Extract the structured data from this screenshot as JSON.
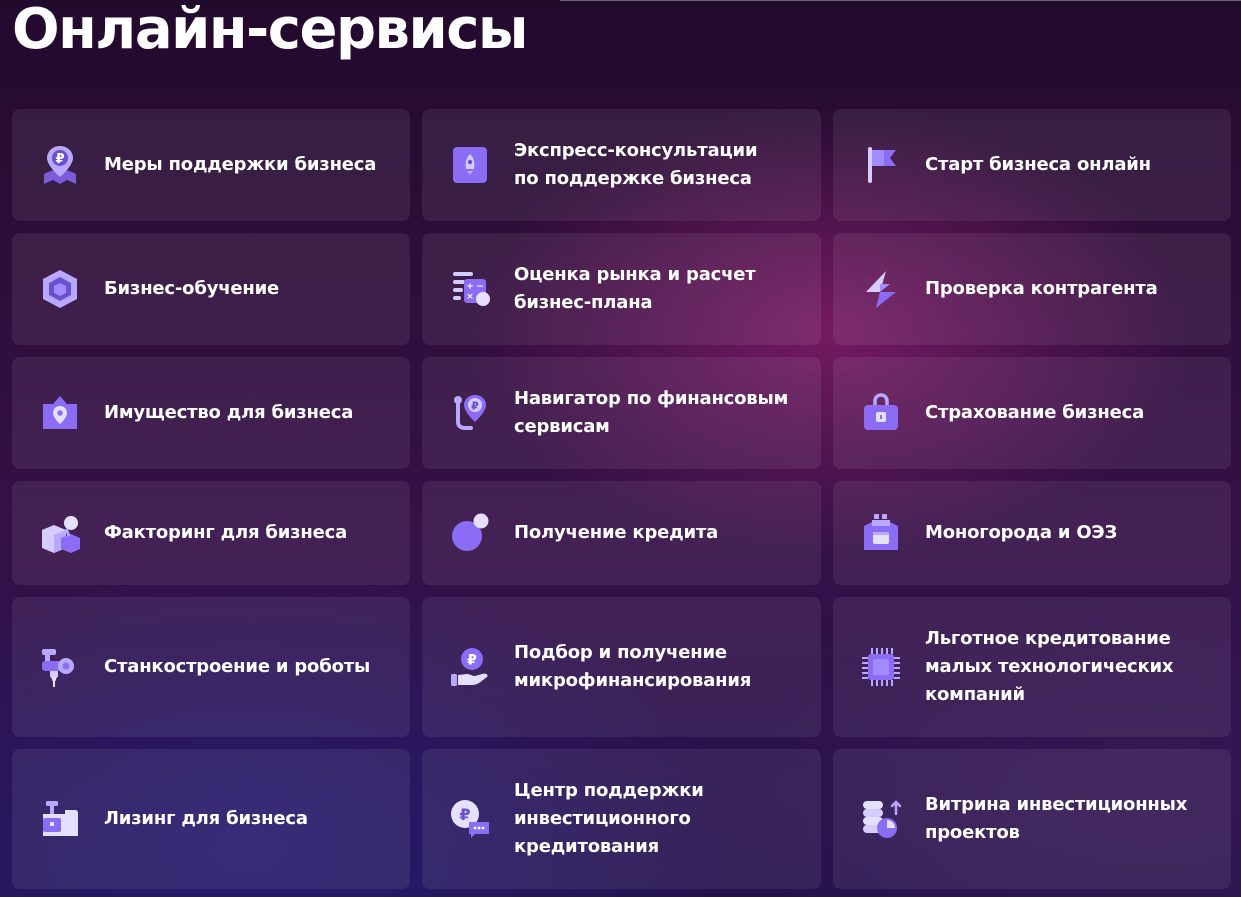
{
  "page": {
    "title": "Онлайн-сервисы"
  },
  "colors": {
    "accent": "#8b6cf5",
    "accent_light": "#c3b3ff",
    "card_background": "rgba(255,255,255,0.075)"
  },
  "services": [
    {
      "label": "Меры поддержки бизнеса",
      "icon": "map-ruble-pin-icon"
    },
    {
      "label": "Экспресс-консультации\nпо поддержке бизнеса",
      "icon": "rocket-icon"
    },
    {
      "label": "Старт бизнеса онлайн",
      "icon": "flag-icon"
    },
    {
      "label": "Бизнес-обучение",
      "icon": "hexagon-cube-icon"
    },
    {
      "label": "Оценка рынка и расчет\nбизнес-плана",
      "icon": "calculator-icon"
    },
    {
      "label": "Проверка контрагента",
      "icon": "lightning-icon"
    },
    {
      "label": "Имущество для бизнеса",
      "icon": "property-pin-icon"
    },
    {
      "label": "Навигатор по финансовым\nсервисам",
      "icon": "navigator-ruble-icon"
    },
    {
      "label": "Страхование бизнеса",
      "icon": "lock-case-icon"
    },
    {
      "label": "Факторинг для бизнеса",
      "icon": "boxes-icon"
    },
    {
      "label": "Получение кредита",
      "icon": "circles-icon"
    },
    {
      "label": "Моногорода и ОЭЗ",
      "icon": "factory-icon"
    },
    {
      "label": "Станкостроение и роботы",
      "icon": "robot-arm-icon"
    },
    {
      "label": "Подбор и получение\nмикрофинансирования",
      "icon": "hand-ruble-icon"
    },
    {
      "label": "Льготное кредитование\nмалых технологических\nкомпаний",
      "icon": "chip-icon"
    },
    {
      "label": "Лизинг для бизнеса",
      "icon": "machine-icon"
    },
    {
      "label": "Центр поддержки\nинвестиционного\nкредитования",
      "icon": "ruble-chat-icon"
    },
    {
      "label": "Витрина инвестиционных\nпроектов",
      "icon": "coins-chart-icon"
    }
  ]
}
